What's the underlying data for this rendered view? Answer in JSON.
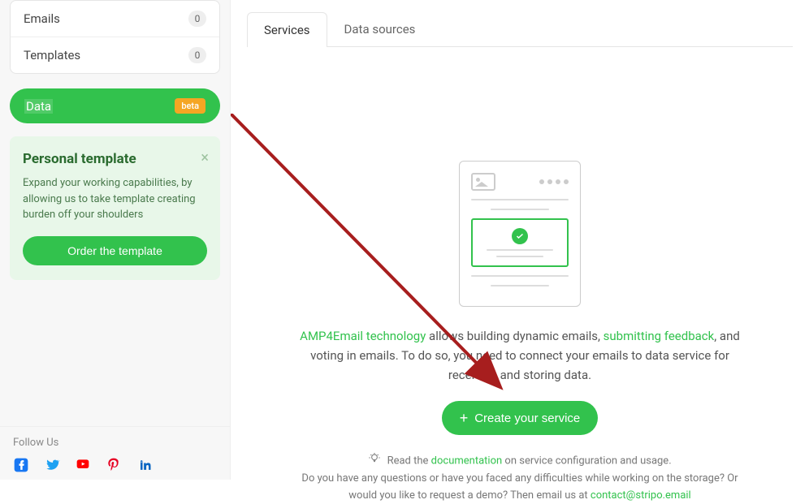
{
  "sidebar": {
    "nav": [
      {
        "label": "Emails",
        "count": "0"
      },
      {
        "label": "Templates",
        "count": "0"
      }
    ],
    "data_item": {
      "label": "Data",
      "badge": "beta"
    },
    "promo": {
      "title": "Personal template",
      "text": "Expand your working capabilities, by allowing us to take template creating burden off your shoulders",
      "cta": "Order the template"
    },
    "follow_label": "Follow Us"
  },
  "tabs": [
    {
      "label": "Services",
      "active": true
    },
    {
      "label": "Data sources",
      "active": false
    }
  ],
  "content": {
    "desc_link1": "AMP4Email technology",
    "desc_part1": " allows building dynamic emails, ",
    "desc_link2": "submitting feedback",
    "desc_part2": ", and voting in emails. To do so, you need to connect your emails to data service for receiving and storing data.",
    "create_label": "Create your service",
    "footer_read": "Read the ",
    "footer_doc": "documentation",
    "footer_read2": " on service configuration and usage.",
    "footer_q": "Do you have any questions or have you faced any difficulties while working on the storage? Or would you like to request a demo? Then email us at ",
    "footer_email": "contact@stripo.email"
  }
}
